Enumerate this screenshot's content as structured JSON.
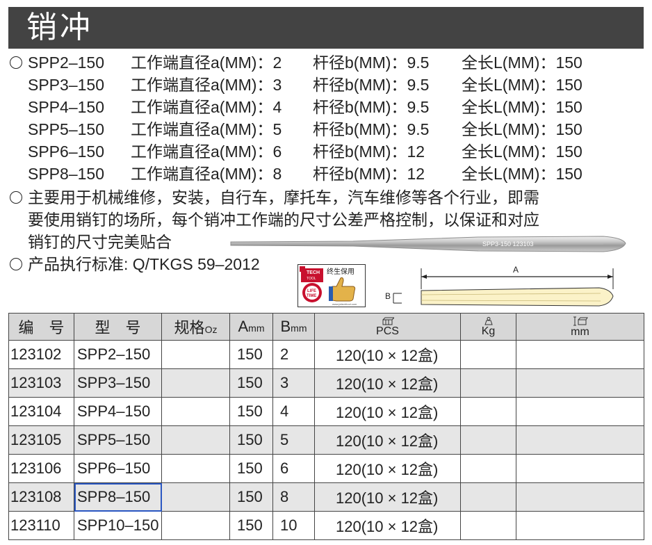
{
  "title": "销冲",
  "specs": [
    {
      "model": "SPP2–150",
      "a_label": "工作端直径a(MM)：",
      "a": "2",
      "b_label": "杆径b(MM)：",
      "b": "9.5",
      "l_label": "全长L(MM)：",
      "l": "150"
    },
    {
      "model": "SPP3–150",
      "a_label": "工作端直径a(MM)：",
      "a": "3",
      "b_label": "杆径b(MM)：",
      "b": "9.5",
      "l_label": "全长L(MM)：",
      "l": "150"
    },
    {
      "model": "SPP4–150",
      "a_label": "工作端直径a(MM)：",
      "a": "4",
      "b_label": "杆径b(MM)：",
      "b": "9.5",
      "l_label": "全长L(MM)：",
      "l": "150"
    },
    {
      "model": "SPP5–150",
      "a_label": "工作端直径a(MM)：",
      "a": "5",
      "b_label": "杆径b(MM)：",
      "b": "9.5",
      "l_label": "全长L(MM)：",
      "l": "150"
    },
    {
      "model": "SPP6–150",
      "a_label": "工作端直径a(MM)：",
      "a": "6",
      "b_label": "杆径b(MM)：",
      "b": "12",
      "l_label": "全长L(MM)：",
      "l": "150"
    },
    {
      "model": "SPP8–150",
      "a_label": "工作端直径a(MM)：",
      "a": "8",
      "b_label": "杆径b(MM)：",
      "b": "12",
      "l_label": "全长L(MM)：",
      "l": "150"
    }
  ],
  "usage": {
    "line1": "主要用于机械维修，安装，自行车，摩托车，汽车维修等各个行业，即需",
    "line2": "要使用销钉的场所，每个销冲工作端的尺寸公差严格控制，以保证和对应",
    "line3": "销钉的尺寸完美贴合"
  },
  "standard": "产品执行标准: Q/TKGS 59–2012",
  "product_engraving": "SPP3-150  123103",
  "logo": {
    "brand": "TECH",
    "brand_sub": "TOOL",
    "lifetime_1": "LIFE",
    "lifetime_2": "TIME",
    "warranty": "终生保用",
    "url": "www.jetechtool.com"
  },
  "diagram": {
    "label_a": "A",
    "label_b": "B"
  },
  "table": {
    "headers": {
      "code": "编　号",
      "model": "型　号",
      "spec": "规格",
      "spec_unit": "Oz",
      "a": "A",
      "a_unit": "mm",
      "b": "B",
      "b_unit": "mm",
      "pcs": "PCS",
      "kg": "Kg",
      "mm": "mm"
    },
    "rows": [
      {
        "code": "123102",
        "model": "SPP2–150",
        "spec": "",
        "a": "150",
        "b": "2",
        "pcs": "120(10 × 12盒)",
        "kg": "",
        "mm": ""
      },
      {
        "code": "123103",
        "model": "SPP3–150",
        "spec": "",
        "a": "150",
        "b": "3",
        "pcs": "120(10 × 12盒)",
        "kg": "",
        "mm": ""
      },
      {
        "code": "123104",
        "model": "SPP4–150",
        "spec": "",
        "a": "150",
        "b": "4",
        "pcs": "120(10 × 12盒)",
        "kg": "",
        "mm": ""
      },
      {
        "code": "123105",
        "model": "SPP5–150",
        "spec": "",
        "a": "150",
        "b": "5",
        "pcs": "120(10 × 12盒)",
        "kg": "",
        "mm": ""
      },
      {
        "code": "123106",
        "model": "SPP6–150",
        "spec": "",
        "a": "150",
        "b": "6",
        "pcs": "120(10 × 12盒)",
        "kg": "",
        "mm": ""
      },
      {
        "code": "123108",
        "model": "SPP8–150",
        "spec": "",
        "a": "150",
        "b": "8",
        "pcs": "120(10 × 12盒)",
        "kg": "",
        "mm": ""
      },
      {
        "code": "123110",
        "model": "SPP10–150",
        "spec": "",
        "a": "150",
        "b": "10",
        "pcs": "120(10 × 12盒)",
        "kg": "",
        "mm": ""
      }
    ]
  },
  "colors": {
    "title_bg": "#434343",
    "header_bg": "#d7d7d7",
    "stripe_bg": "#e6e6e6",
    "selection": "#2a57c2",
    "diagram_fill": "#fbf2c8",
    "logo_red": "#c8102e"
  }
}
